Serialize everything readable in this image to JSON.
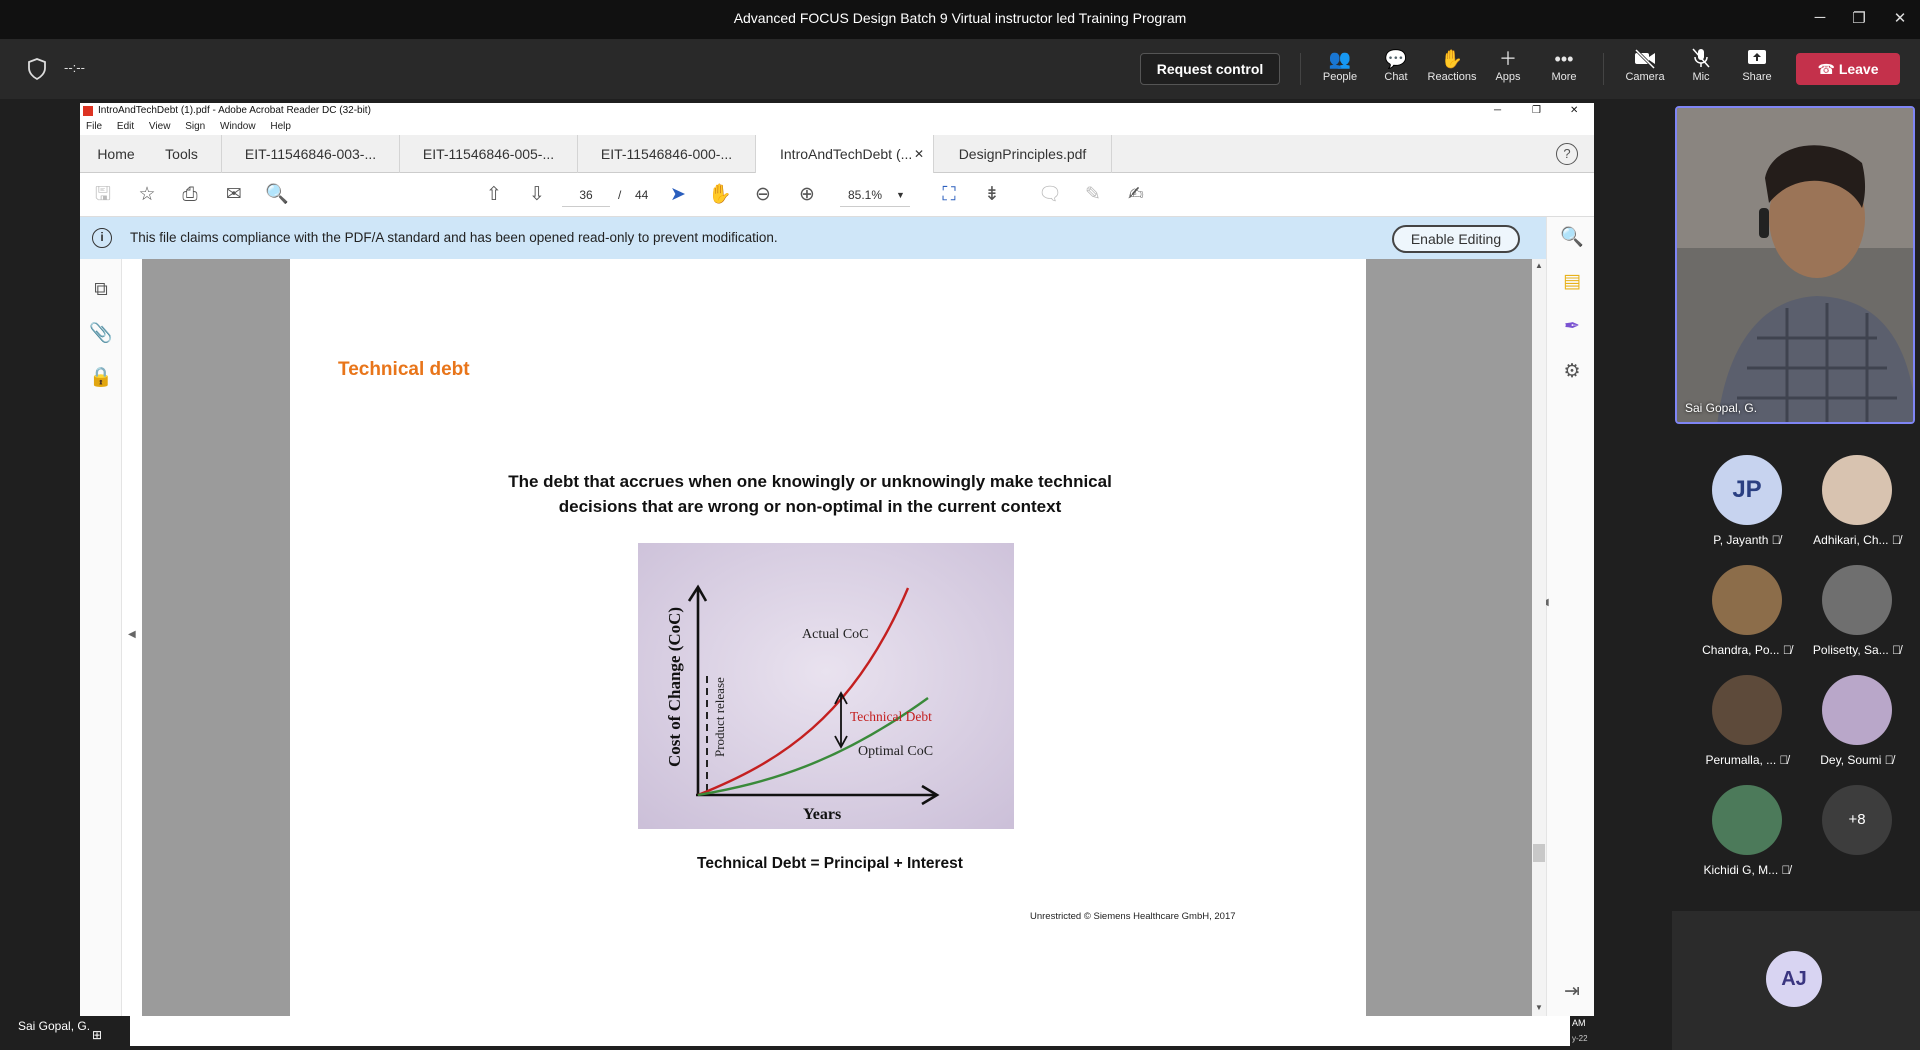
{
  "window": {
    "title": "Advanced FOCUS Design Batch 9 Virtual instructor led Training Program",
    "minimize": "─",
    "restore": "❐",
    "close": "✕"
  },
  "meeting_bar": {
    "timer": "--:--",
    "request_control": "Request control",
    "buttons": [
      {
        "label": "People",
        "icon": "people-icon"
      },
      {
        "label": "Chat",
        "icon": "chat-icon"
      },
      {
        "label": "Reactions",
        "icon": "reactions-icon"
      },
      {
        "label": "Apps",
        "icon": "apps-icon"
      },
      {
        "label": "More",
        "icon": "more-icon"
      },
      {
        "label": "Camera",
        "icon": "camera-off-icon"
      },
      {
        "label": "Mic",
        "icon": "mic-off-icon"
      },
      {
        "label": "Share",
        "icon": "share-icon"
      }
    ],
    "leave": "Leave",
    "leave_color": "#c4314b"
  },
  "acrobat": {
    "title": "IntroAndTechDebt (1).pdf - Adobe Acrobat Reader DC (32-bit)",
    "menu": [
      "File",
      "Edit",
      "View",
      "Sign",
      "Window",
      "Help"
    ],
    "tabs": [
      "Home",
      "Tools",
      "EIT-11546846-003-...",
      "EIT-11546846-005-...",
      "EIT-11546846-000-...",
      "IntroAndTechDebt (...",
      "DesignPrinciples.pdf"
    ],
    "tab_close": "✕",
    "help": "?",
    "page_current": "36",
    "page_sep": "/",
    "page_total": "44",
    "zoom": "85.1%",
    "info_text": "This file claims compliance with the PDF/A standard and has been opened read-only to prevent modification.",
    "enable_editing": "Enable Editing"
  },
  "slide": {
    "title": "Technical debt",
    "title_color": "#e8751a",
    "definition_line1": "The debt that accrues when one knowingly or unknowingly make technical",
    "definition_line2": "decisions that are wrong or non-optimal in the current context",
    "graph": {
      "y_label": "Cost of Change (CoC)",
      "x_label": "Years",
      "marker_label": "Product release",
      "actual_label": "Actual CoC",
      "optimal_label": "Optimal CoC",
      "debt_label": "Technical Debt"
    },
    "formula": "Technical Debt = Principal + Interest",
    "copyright": "Unrestricted © Siemens Healthcare GmbH, 2017"
  },
  "participants": {
    "self_name": "Sai Gopal, G.",
    "people": [
      {
        "name": "P, Jayanth",
        "initials": "JP",
        "color": "#c7d3ef"
      },
      {
        "name": "Adhikari, Ch...",
        "initials": "",
        "color": "#d8c3b0"
      },
      {
        "name": "Chandra, Po...",
        "initials": "",
        "color": "#8c6d4a"
      },
      {
        "name": "Polisetty, Sa...",
        "initials": "",
        "color": "#6f6f6f"
      },
      {
        "name": "Perumalla, ...",
        "initials": "",
        "color": "#5d4a3a"
      },
      {
        "name": "Dey, Soumi",
        "initials": "",
        "color": "#b9a7c9"
      },
      {
        "name": "Kichidi G, M...",
        "initials": "",
        "color": "#4c7a5a"
      },
      {
        "name": "",
        "initials": "+8",
        "color": "#3d3d3d"
      }
    ],
    "aj_initials": "AJ",
    "bottom_name": "Sai Gopal, G.",
    "clock_top": "AM",
    "clock_bottom": "y-22"
  }
}
